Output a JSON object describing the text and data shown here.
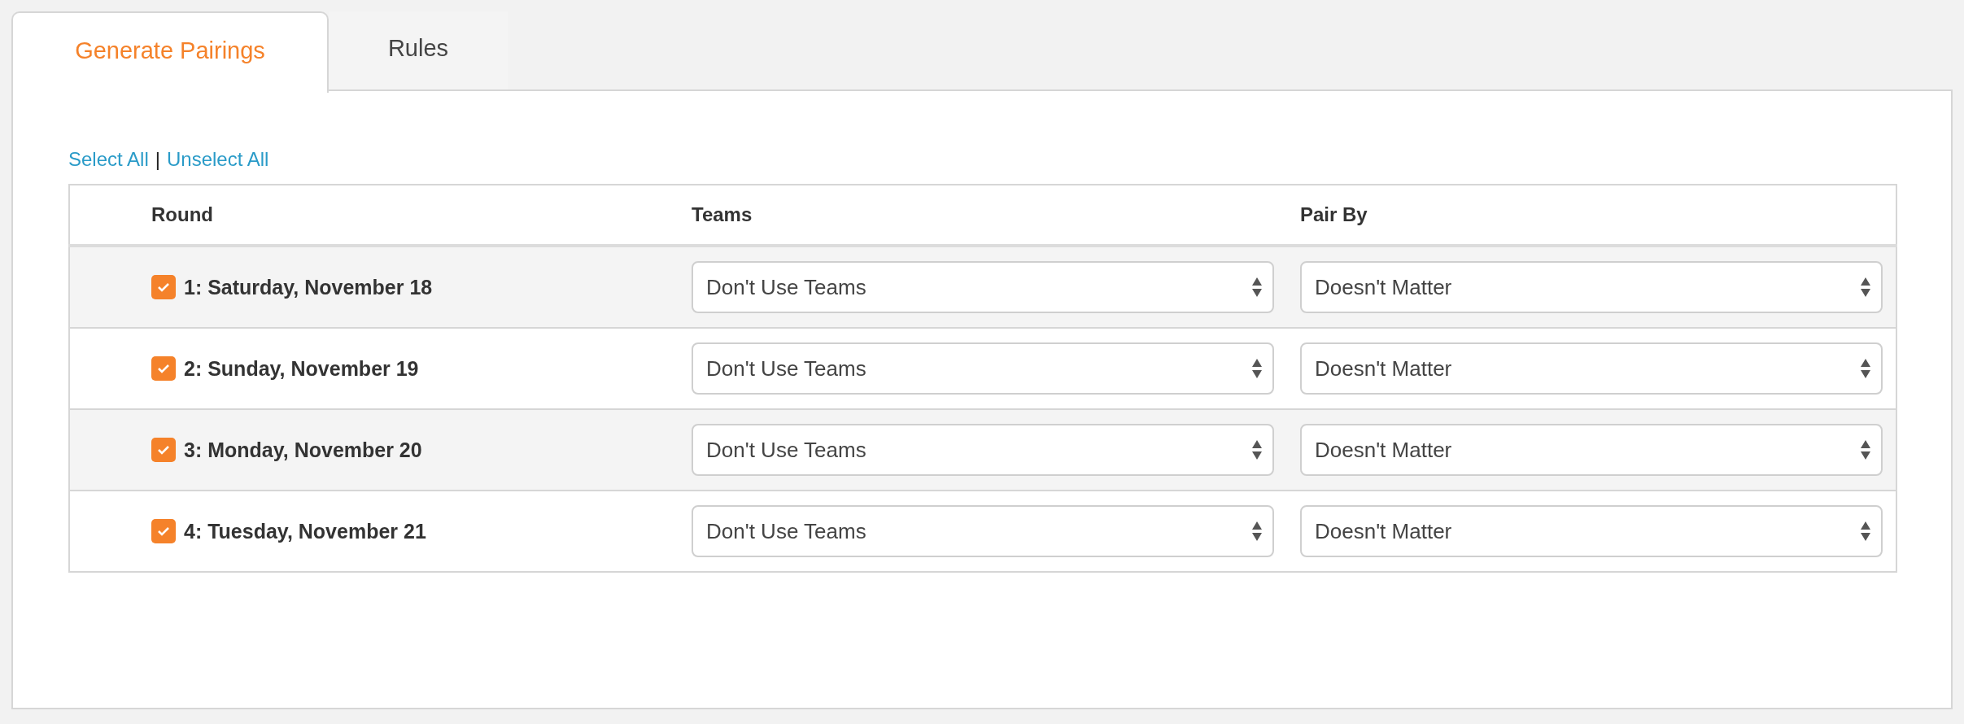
{
  "tabs": [
    {
      "label": "Generate Pairings",
      "selected": true
    },
    {
      "label": "Rules",
      "selected": false
    }
  ],
  "selection_links": [
    {
      "label": "Select All"
    },
    {
      "label": "Unselect All"
    }
  ],
  "separator": "|",
  "table": {
    "columns": [
      "Round",
      "Teams",
      "Pair By"
    ],
    "rows": [
      {
        "round": "1: Saturday, November 18",
        "checked": true,
        "teams": "Don't Use Teams",
        "pair_by": "Doesn't Matter"
      },
      {
        "round": "2: Sunday, November 19",
        "checked": true,
        "teams": "Don't Use Teams",
        "pair_by": "Doesn't Matter"
      },
      {
        "round": "3: Monday, November 20",
        "checked": true,
        "teams": "Don't Use Teams",
        "pair_by": "Doesn't Matter"
      },
      {
        "round": "4: Tuesday, November 21",
        "checked": true,
        "teams": "Don't Use Teams",
        "pair_by": "Doesn't Matter"
      }
    ]
  }
}
